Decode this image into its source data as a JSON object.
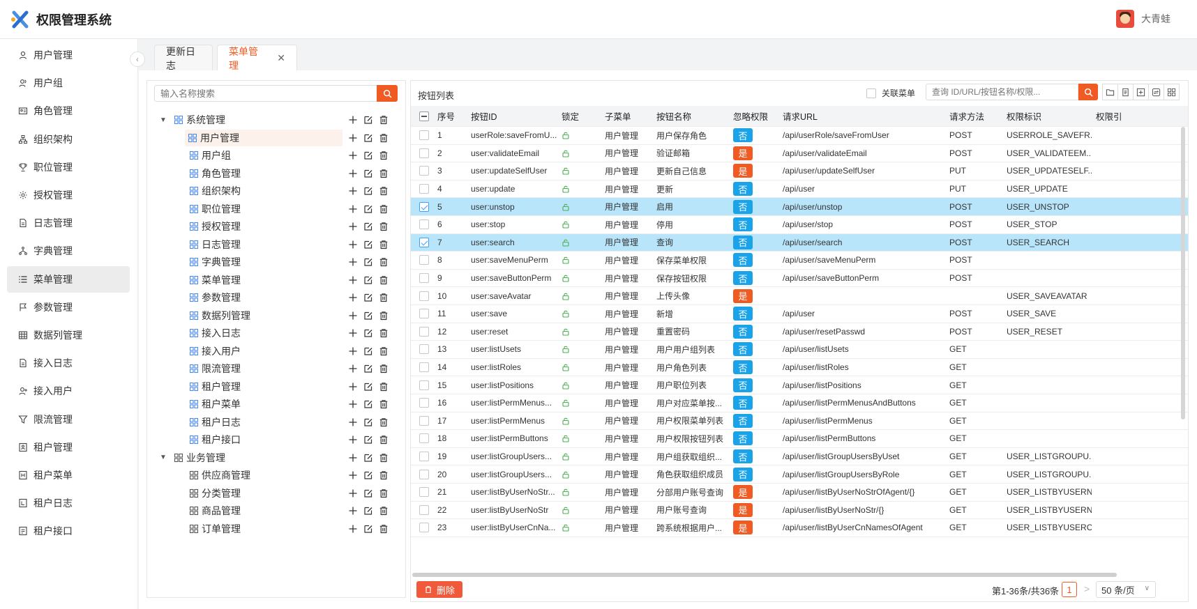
{
  "header": {
    "title": "权限管理系统",
    "user_name": "大青蛙"
  },
  "sidebar": {
    "active_index": 8,
    "items": [
      {
        "label": "用户管理",
        "icon": "user-icon"
      },
      {
        "label": "用户组",
        "icon": "user-group-icon"
      },
      {
        "label": "角色管理",
        "icon": "id-card-icon"
      },
      {
        "label": "组织架构",
        "icon": "org-chart-icon"
      },
      {
        "label": "职位管理",
        "icon": "trophy-icon"
      },
      {
        "label": "授权管理",
        "icon": "gear-icon"
      },
      {
        "label": "日志管理",
        "icon": "document-icon"
      },
      {
        "label": "字典管理",
        "icon": "branch-icon"
      },
      {
        "label": "菜单管理",
        "icon": "list-icon"
      },
      {
        "label": "参数管理",
        "icon": "flag-icon"
      },
      {
        "label": "数据列管理",
        "icon": "table-icon"
      },
      {
        "label": "接入日志",
        "icon": "document-icon"
      },
      {
        "label": "接入用户",
        "icon": "user-plus-icon"
      },
      {
        "label": "限流管理",
        "icon": "filter-icon"
      },
      {
        "label": "租户管理",
        "icon": "tenant-icon"
      },
      {
        "label": "租户菜单",
        "icon": "tenant-menu-icon"
      },
      {
        "label": "租户日志",
        "icon": "tenant-log-icon"
      },
      {
        "label": "租户接口",
        "icon": "tenant-api-icon"
      }
    ]
  },
  "tabs": [
    {
      "label": "更新日志",
      "active": false
    },
    {
      "label": "菜单管理",
      "active": true,
      "close": "✕"
    }
  ],
  "tree": {
    "search_placeholder": "输入名称搜索",
    "nodes": [
      {
        "label": "系统管理",
        "level": 0,
        "expanded": true,
        "icon": "grid-blue-icon"
      },
      {
        "label": "用户管理",
        "level": 1,
        "selected": true,
        "icon": "grid-blue-icon"
      },
      {
        "label": "用户组",
        "level": 1,
        "icon": "grid-blue-icon"
      },
      {
        "label": "角色管理",
        "level": 1,
        "icon": "grid-blue-icon"
      },
      {
        "label": "组织架构",
        "level": 1,
        "icon": "grid-blue-icon"
      },
      {
        "label": "职位管理",
        "level": 1,
        "icon": "grid-blue-icon"
      },
      {
        "label": "授权管理",
        "level": 1,
        "icon": "grid-blue-icon"
      },
      {
        "label": "日志管理",
        "level": 1,
        "icon": "grid-blue-icon"
      },
      {
        "label": "字典管理",
        "level": 1,
        "icon": "grid-blue-icon"
      },
      {
        "label": "菜单管理",
        "level": 1,
        "icon": "grid-blue-icon"
      },
      {
        "label": "参数管理",
        "level": 1,
        "icon": "grid-blue-icon"
      },
      {
        "label": "数据列管理",
        "level": 1,
        "icon": "grid-blue-icon"
      },
      {
        "label": "接入日志",
        "level": 1,
        "icon": "grid-blue-icon"
      },
      {
        "label": "接入用户",
        "level": 1,
        "icon": "grid-blue-icon"
      },
      {
        "label": "限流管理",
        "level": 1,
        "icon": "grid-blue-icon"
      },
      {
        "label": "租户管理",
        "level": 1,
        "icon": "grid-blue-icon"
      },
      {
        "label": "租户菜单",
        "level": 1,
        "icon": "grid-blue-icon"
      },
      {
        "label": "租户日志",
        "level": 1,
        "icon": "grid-blue-icon"
      },
      {
        "label": "租户接口",
        "level": 1,
        "icon": "grid-blue-icon"
      },
      {
        "label": "业务管理",
        "level": 0,
        "expanded": true,
        "icon": "grid-gray-icon"
      },
      {
        "label": "供应商管理",
        "level": 1,
        "icon": "grid-gray-icon"
      },
      {
        "label": "分类管理",
        "level": 1,
        "icon": "grid-gray-icon"
      },
      {
        "label": "商品管理",
        "level": 1,
        "icon": "grid-gray-icon"
      },
      {
        "label": "订单管理",
        "level": 1,
        "icon": "grid-gray-icon"
      }
    ]
  },
  "button_list": {
    "title": "按钮列表",
    "related_menu_label": "关联菜单",
    "query_placeholder": "查询 ID/URL/按钮名称/权限...",
    "columns": [
      "序号",
      "按钮ID",
      "锁定",
      "子菜单",
      "按钮名称",
      "忽略权限",
      "请求URL",
      "请求方法",
      "权限标识",
      "权限引"
    ],
    "rows": [
      {
        "no": "1",
        "id": "userRole:saveFromU...",
        "sub": "用户管理",
        "name": "用户保存角色",
        "ignore": "否",
        "url": "/api/userRole/saveFromUser",
        "method": "POST",
        "perm": "USERROLE_SAVEFR...",
        "checked": false
      },
      {
        "no": "2",
        "id": "user:validateEmail",
        "sub": "用户管理",
        "name": "验证邮箱",
        "ignore": "是",
        "url": "/api/user/validateEmail",
        "method": "POST",
        "perm": "USER_VALIDATEEM...",
        "checked": false
      },
      {
        "no": "3",
        "id": "user:updateSelfUser",
        "sub": "用户管理",
        "name": "更新自己信息",
        "ignore": "是",
        "url": "/api/user/updateSelfUser",
        "method": "PUT",
        "perm": "USER_UPDATESELF...",
        "checked": false
      },
      {
        "no": "4",
        "id": "user:update",
        "sub": "用户管理",
        "name": "更新",
        "ignore": "否",
        "url": "/api/user",
        "method": "PUT",
        "perm": "USER_UPDATE",
        "checked": false
      },
      {
        "no": "5",
        "id": "user:unstop",
        "sub": "用户管理",
        "name": "启用",
        "ignore": "否",
        "url": "/api/user/unstop",
        "method": "POST",
        "perm": "USER_UNSTOP",
        "checked": true
      },
      {
        "no": "6",
        "id": "user:stop",
        "sub": "用户管理",
        "name": "停用",
        "ignore": "否",
        "url": "/api/user/stop",
        "method": "POST",
        "perm": "USER_STOP",
        "checked": false
      },
      {
        "no": "7",
        "id": "user:search",
        "sub": "用户管理",
        "name": "查询",
        "ignore": "否",
        "url": "/api/user/search",
        "method": "POST",
        "perm": "USER_SEARCH",
        "checked": true
      },
      {
        "no": "8",
        "id": "user:saveMenuPerm",
        "sub": "用户管理",
        "name": "保存菜单权限",
        "ignore": "否",
        "url": "/api/user/saveMenuPerm",
        "method": "POST",
        "perm": "",
        "checked": false
      },
      {
        "no": "9",
        "id": "user:saveButtonPerm",
        "sub": "用户管理",
        "name": "保存按钮权限",
        "ignore": "否",
        "url": "/api/user/saveButtonPerm",
        "method": "POST",
        "perm": "",
        "checked": false
      },
      {
        "no": "10",
        "id": "user:saveAvatar",
        "sub": "用户管理",
        "name": "上传头像",
        "ignore": "是",
        "url": "",
        "method": "",
        "perm": "USER_SAVEAVATAR",
        "checked": false
      },
      {
        "no": "11",
        "id": "user:save",
        "sub": "用户管理",
        "name": "新增",
        "ignore": "否",
        "url": "/api/user",
        "method": "POST",
        "perm": "USER_SAVE",
        "checked": false
      },
      {
        "no": "12",
        "id": "user:reset",
        "sub": "用户管理",
        "name": "重置密码",
        "ignore": "否",
        "url": "/api/user/resetPasswd",
        "method": "POST",
        "perm": "USER_RESET",
        "checked": false
      },
      {
        "no": "13",
        "id": "user:listUsets",
        "sub": "用户管理",
        "name": "用户用户组列表",
        "ignore": "否",
        "url": "/api/user/listUsets",
        "method": "GET",
        "perm": "",
        "checked": false
      },
      {
        "no": "14",
        "id": "user:listRoles",
        "sub": "用户管理",
        "name": "用户角色列表",
        "ignore": "否",
        "url": "/api/user/listRoles",
        "method": "GET",
        "perm": "",
        "checked": false
      },
      {
        "no": "15",
        "id": "user:listPositions",
        "sub": "用户管理",
        "name": "用户职位列表",
        "ignore": "否",
        "url": "/api/user/listPositions",
        "method": "GET",
        "perm": "",
        "checked": false
      },
      {
        "no": "16",
        "id": "user:listPermMenus...",
        "sub": "用户管理",
        "name": "用户对应菜单按...",
        "ignore": "否",
        "url": "/api/user/listPermMenusAndButtons",
        "method": "GET",
        "perm": "",
        "checked": false
      },
      {
        "no": "17",
        "id": "user:listPermMenus",
        "sub": "用户管理",
        "name": "用户权限菜单列表",
        "ignore": "否",
        "url": "/api/user/listPermMenus",
        "method": "GET",
        "perm": "",
        "checked": false
      },
      {
        "no": "18",
        "id": "user:listPermButtons",
        "sub": "用户管理",
        "name": "用户权限按钮列表",
        "ignore": "否",
        "url": "/api/user/listPermButtons",
        "method": "GET",
        "perm": "",
        "checked": false
      },
      {
        "no": "19",
        "id": "user:listGroupUsers...",
        "sub": "用户管理",
        "name": "用户组获取组织...",
        "ignore": "否",
        "url": "/api/user/listGroupUsersByUset",
        "method": "GET",
        "perm": "USER_LISTGROUPU...",
        "checked": false
      },
      {
        "no": "20",
        "id": "user:listGroupUsers...",
        "sub": "用户管理",
        "name": "角色获取组织成员",
        "ignore": "否",
        "url": "/api/user/listGroupUsersByRole",
        "method": "GET",
        "perm": "USER_LISTGROUPU...",
        "checked": false
      },
      {
        "no": "21",
        "id": "user:listByUserNoStr...",
        "sub": "用户管理",
        "name": "分部用户账号查询",
        "ignore": "是",
        "url": "/api/user/listByUserNoStrOfAgent/{}",
        "method": "GET",
        "perm": "USER_LISTBYUSERN...",
        "checked": false
      },
      {
        "no": "22",
        "id": "user:listByUserNoStr",
        "sub": "用户管理",
        "name": "用户账号查询",
        "ignore": "是",
        "url": "/api/user/listByUserNoStr/{}",
        "method": "GET",
        "perm": "USER_LISTBYUSERN...",
        "checked": false
      },
      {
        "no": "23",
        "id": "user:listByUserCnNa...",
        "sub": "用户管理",
        "name": "跨系统根据用户...",
        "ignore": "是",
        "url": "/api/user/listByUserCnNamesOfAgent",
        "method": "GET",
        "perm": "USER_LISTBYUSERC...",
        "checked": false
      }
    ],
    "delete_label": "删除",
    "pager": {
      "info": "第1-36条/共36条",
      "current": "1",
      "prev": "<",
      "next": ">",
      "page_size": "50 条/页"
    }
  },
  "colors": {
    "accent": "#f05a23",
    "tag_no": "#1aa3e8",
    "tag_yes": "#f05a23",
    "row_checked": "#b9e5fb"
  }
}
